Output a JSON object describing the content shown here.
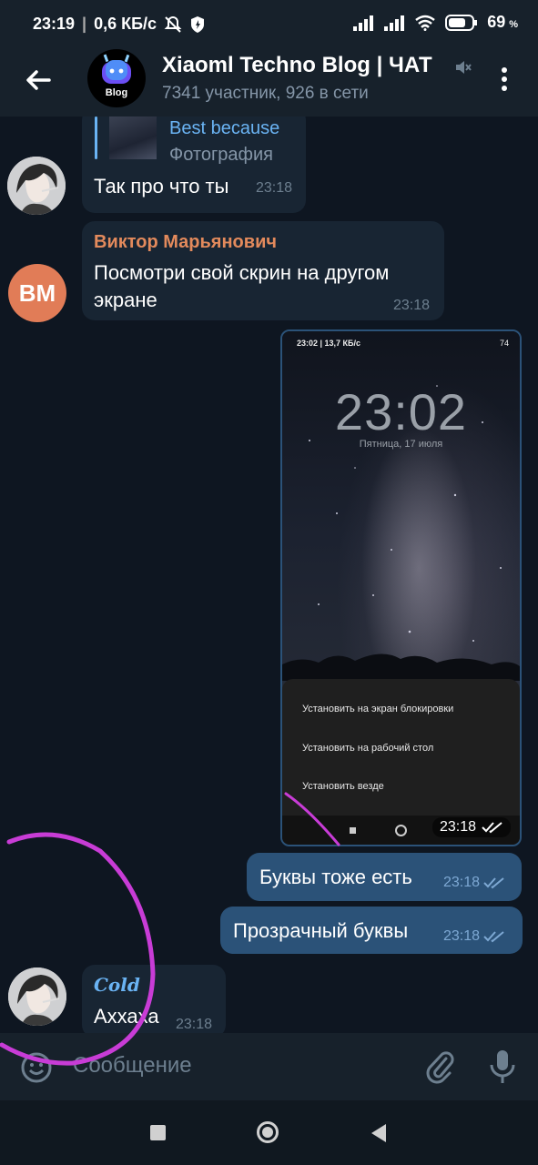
{
  "statusbar": {
    "time": "23:19",
    "speed": "0,6 КБ/с",
    "battery": "69",
    "battery_unit": "%"
  },
  "header": {
    "title": "Xiaoml Techno Blog | ЧАТ",
    "subtitle": "7341 участник, 926 в сети",
    "avatar_text": "Blog"
  },
  "messages": {
    "m1": {
      "reply_name": "Best because",
      "reply_sub": "Фотография",
      "text": "Так про что ты",
      "time": "23:18"
    },
    "m2": {
      "sender": "Виктор Марьянович",
      "initials": "ВМ",
      "text": "Посмотри свой скрин на другом экране",
      "time": "23:18"
    },
    "m3": {
      "time": "23:18",
      "phone_status": "23:02 | 13,7 КБ/с",
      "phone_battery": "74",
      "clock": "23:02",
      "date": "Пятница, 17 июля",
      "sheet_items": [
        "Установить на экран блокировки",
        "Установить на рабочий стол",
        "Установить везде"
      ]
    },
    "m4": {
      "text": "Буквы тоже есть",
      "time": "23:18"
    },
    "m5": {
      "text": "Прозрачный буквы",
      "time": "23:18"
    },
    "m6": {
      "sender": "Cold",
      "text": "Аххаха",
      "time": "23:18"
    }
  },
  "input": {
    "placeholder": "Сообщение"
  },
  "colors": {
    "header_bg": "#17212b",
    "chat_bg": "#0e1621",
    "in_bubble": "#182533",
    "out_bubble": "#2b5278",
    "reply_name": "#6ab3f3",
    "sender_orange": "#e38a5c",
    "annotation": "#c83cd6"
  }
}
